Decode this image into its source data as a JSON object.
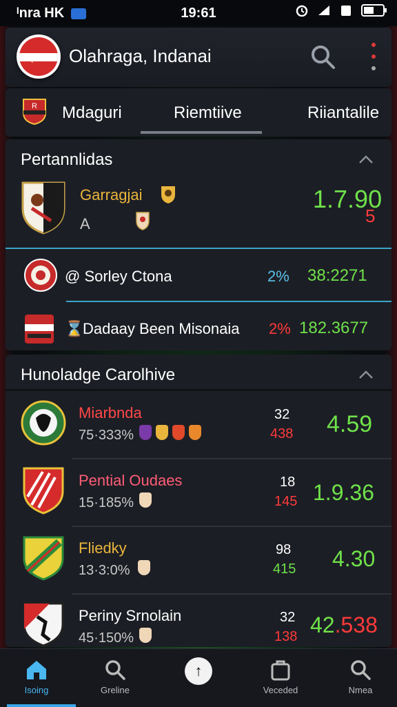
{
  "status_bar": {
    "carrier": "ᴵnra HK",
    "time": "19:61"
  },
  "header": {
    "title": "Olahraga, Indanai"
  },
  "tabs": [
    {
      "label": "Mdaguri"
    },
    {
      "label": "Riemtiive"
    },
    {
      "label": "Riiantalile"
    }
  ],
  "section1": {
    "title": "Pertannlidas",
    "featured": {
      "name": "Garragjai",
      "sub": "A",
      "odds_main": "1.7.",
      "odds_alt": "90",
      "odds_red": "5"
    },
    "rows": [
      {
        "name": "@ Sorley Ctona",
        "pct": "2%",
        "odds": "38:2271"
      },
      {
        "name": "Dadaay Been Misonaia",
        "pct": "2%",
        "odds": "182.3677",
        "prefix": "⌛"
      }
    ]
  },
  "section2": {
    "title": "Hunoladge Carolhive",
    "matches": [
      {
        "name": "Miarbnda",
        "pct": "75·333%",
        "top": "32",
        "bottom": "438",
        "odds": "4.59"
      },
      {
        "name": "Pential Oudaes",
        "pct": "15·185%",
        "top": "18",
        "bottom": "145",
        "odds": "1.9.36"
      },
      {
        "name": "Fliedky",
        "pct": "13·3:0%",
        "top": "98",
        "bottom": "415",
        "odds": "4.30"
      },
      {
        "name": "Periny Srnolain",
        "pct": "45·150%",
        "top": "32",
        "bottom": "138",
        "odds_a": "42",
        "odds_b": ".538"
      }
    ]
  },
  "bottom_nav": [
    {
      "label": "Isoing",
      "icon": "home-icon"
    },
    {
      "label": "Greline",
      "icon": "search-icon"
    },
    {
      "label": "",
      "icon": "pick-icon"
    },
    {
      "label": "Veceded",
      "icon": "bag-icon"
    },
    {
      "label": "Nmea",
      "icon": "search-icon"
    }
  ],
  "colors": {
    "accent": "#3aa6e8",
    "odds_green": "#6fe24a",
    "alert_red": "#ff3a3a",
    "gold": "#e9b53c"
  }
}
